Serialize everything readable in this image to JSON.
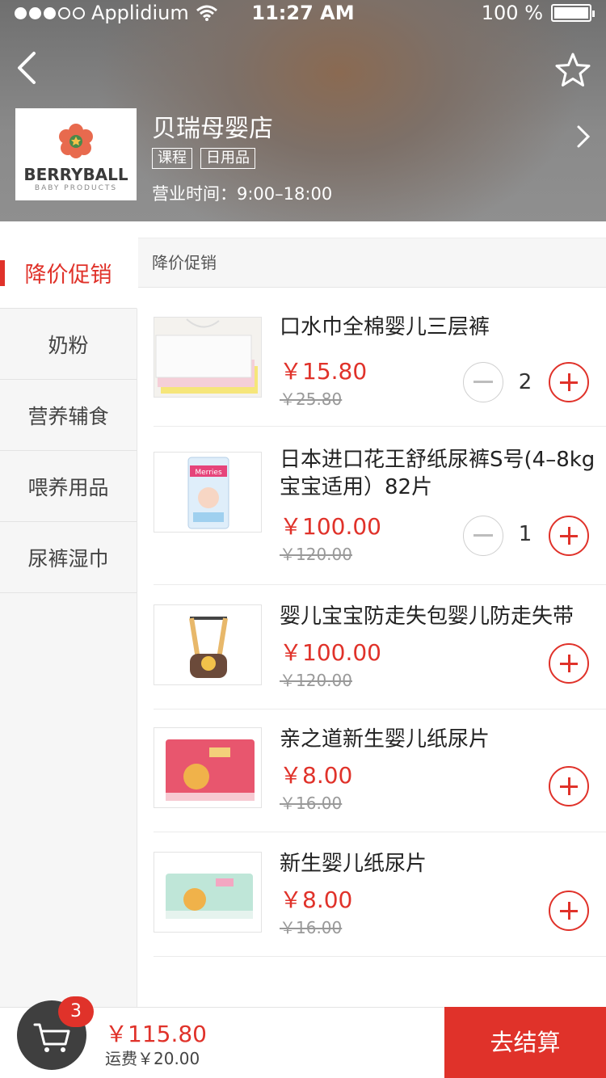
{
  "status_bar": {
    "carrier": "Applidium",
    "time": "11:27 AM",
    "battery": "100 %"
  },
  "store": {
    "logo_text": "BERRYBALL",
    "logo_subtext": "BABY PRODUCTS",
    "name": "贝瑞母婴店",
    "tags": [
      "课程",
      "日用品"
    ],
    "hours": "营业时间：9:00–18:00"
  },
  "sidebar": {
    "items": [
      {
        "label": "降价促销",
        "active": true
      },
      {
        "label": "奶粉"
      },
      {
        "label": "营养辅食"
      },
      {
        "label": "喂养用品"
      },
      {
        "label": "尿裤湿巾"
      }
    ]
  },
  "section": {
    "title": "降价促销"
  },
  "products": [
    {
      "name": "口水巾全棉婴儿三层裤",
      "price": "￥15.80",
      "original_price": "￥25.80",
      "qty": "2"
    },
    {
      "name": "日本进口花王舒纸尿裤S号(4–8kg宝宝适用）82片",
      "price": "￥100.00",
      "original_price": "￥120.00",
      "qty": "1"
    },
    {
      "name": "婴儿宝宝防走失包婴儿防走失带",
      "price": "￥100.00",
      "original_price": "￥120.00"
    },
    {
      "name": "亲之道新生婴儿纸尿片",
      "price": "￥8.00",
      "original_price": "￥16.00"
    },
    {
      "name": "新生婴儿纸尿片",
      "price": "￥8.00",
      "original_price": "￥16.00"
    }
  ],
  "cart": {
    "count": "3",
    "total": "￥115.80",
    "shipping": "运费￥20.00",
    "checkout_label": "去结算"
  },
  "colors": {
    "accent": "#e0322a",
    "sidebar_bg": "#f6f6f6"
  },
  "icons": [
    "back-arrow-icon",
    "star-icon",
    "chevron-right-icon",
    "cart-icon",
    "plus-icon",
    "minus-icon",
    "wifi-icon",
    "battery-icon"
  ]
}
